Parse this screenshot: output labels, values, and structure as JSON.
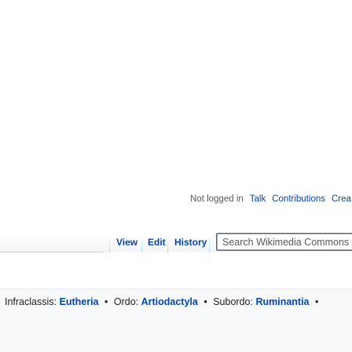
{
  "personal": {
    "not_logged_in": "Not logged in",
    "talk": "Talk",
    "contributions": "Contributions",
    "create": "Crea"
  },
  "views": {
    "view": "View",
    "edit": "Edit",
    "history": "History"
  },
  "search": {
    "placeholder": "Search Wikimedia Commons"
  },
  "taxonomy": {
    "rank_1": "Infraclassis:",
    "value_1": "Eutheria",
    "rank_2": "Ordo:",
    "value_2": "Artiodactyla",
    "rank_3": "Subordo:",
    "value_3": "Ruminantia",
    "separator": "•"
  },
  "colors": {
    "link": "#0645ad",
    "accent_border": "#a7d7f9",
    "search_focus": "#3366cc"
  }
}
